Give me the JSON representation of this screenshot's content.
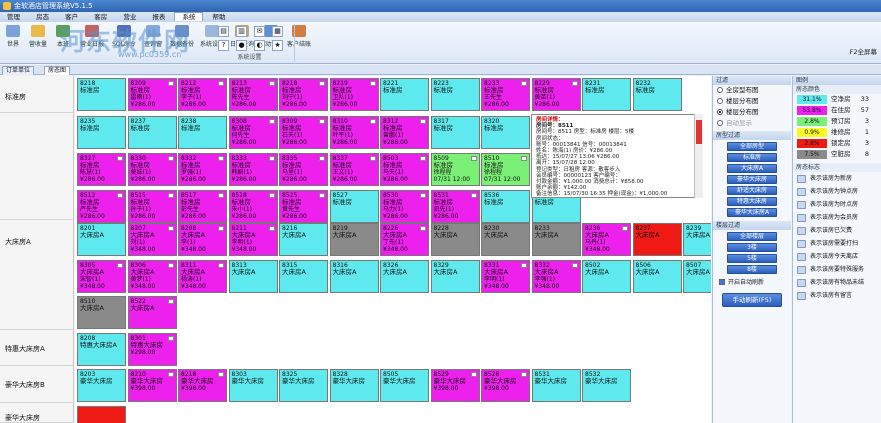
{
  "app": {
    "title": "金软酒店管理系统V5.1.5"
  },
  "menu": [
    "管理",
    "房态",
    "客户",
    "客房",
    "营业",
    "报表",
    "系统",
    "帮助"
  ],
  "menu_active": "系统",
  "ribbon": {
    "buttons": [
      "世界",
      "营收量",
      "本班",
      "营业日报",
      "SQL命令",
      "查询窗",
      "数据备份",
      "系统设置",
      "日志查询",
      "自动设置",
      "客户结账",
      "交接"
    ],
    "group_label": "系统设置",
    "right_status": "F2全屏幕"
  },
  "watermark": {
    "main": "河东软件网",
    "url": "www.pc0359.cn"
  },
  "tabs": [
    "订单单位",
    "房态图"
  ],
  "categories": [
    "标准房",
    "",
    "大床房A",
    "",
    "",
    "特惠大床房A",
    "豪华大床房B",
    "豪华大床房"
  ],
  "colors": {
    "magenta": "#ee20ee",
    "cyan": "#5ee9ee",
    "gray": "#8a8a8a",
    "green": "#7bf076",
    "yellow": "#fafa22",
    "red": "#f01a14"
  },
  "rooms": [
    {
      "r": 0,
      "c": 0,
      "no": "8218",
      "type": "标准房",
      "sub": "",
      "price": "",
      "st": "cyan"
    },
    {
      "r": 0,
      "c": 1,
      "no": "8209",
      "type": "标准房",
      "sub": "雷雨(1)",
      "price": "¥286.00",
      "st": "magenta"
    },
    {
      "r": 0,
      "c": 2,
      "no": "8212",
      "type": "标准房",
      "sub": "李子(1)",
      "price": "¥286.00",
      "st": "magenta"
    },
    {
      "r": 0,
      "c": 3,
      "no": "8213",
      "type": "标准房",
      "sub": "陈先生",
      "price": "¥286.00",
      "st": "magenta"
    },
    {
      "r": 0,
      "c": 4,
      "no": "8218",
      "type": "标准房",
      "sub": "刘宁(1)",
      "price": "¥286.00",
      "st": "magenta"
    },
    {
      "r": 0,
      "c": 5,
      "no": "8219",
      "type": "标准房",
      "sub": "卫队(1)",
      "price": "¥286.00",
      "st": "magenta"
    },
    {
      "r": 0,
      "c": 6,
      "no": "8221",
      "type": "标准房",
      "sub": "",
      "price": "",
      "st": "cyan"
    },
    {
      "r": 0,
      "c": 7,
      "no": "8223",
      "type": "标准房",
      "sub": "",
      "price": "",
      "st": "cyan"
    },
    {
      "r": 0,
      "c": 8,
      "no": "8233",
      "type": "标准房",
      "sub": "王先生",
      "price": "¥286.00",
      "st": "magenta"
    },
    {
      "r": 0,
      "c": 9,
      "no": "8229",
      "type": "标准房",
      "sub": "黄苗(1)",
      "price": "¥286.00",
      "st": "magenta"
    },
    {
      "r": 0,
      "c": 10,
      "no": "8231",
      "type": "标准房",
      "sub": "",
      "price": "",
      "st": "cyan"
    },
    {
      "r": 0,
      "c": 11,
      "no": "8232",
      "type": "标准房",
      "sub": "",
      "price": "",
      "st": "cyan"
    },
    {
      "r": 1,
      "c": 0,
      "no": "8235",
      "type": "标准房",
      "sub": "",
      "price": "",
      "st": "cyan"
    },
    {
      "r": 1,
      "c": 1,
      "no": "8237",
      "type": "标准房",
      "sub": "",
      "price": "",
      "st": "cyan"
    },
    {
      "r": 1,
      "c": 2,
      "no": "8238",
      "type": "标准房",
      "sub": "",
      "price": "",
      "st": "cyan"
    },
    {
      "r": 1,
      "c": 3,
      "no": "8308",
      "type": "标准房",
      "sub": "何先生",
      "price": "¥286.00",
      "st": "magenta"
    },
    {
      "r": 1,
      "c": 4,
      "no": "8309",
      "type": "标准房",
      "sub": "石天(1)",
      "price": "¥286.00",
      "st": "magenta"
    },
    {
      "r": 1,
      "c": 5,
      "no": "8310",
      "type": "标准房",
      "sub": "叶平(1)",
      "price": "¥286.00",
      "st": "magenta"
    },
    {
      "r": 1,
      "c": 6,
      "no": "8312",
      "type": "标准房",
      "sub": "曾鹏(1)",
      "price": "¥286.00",
      "st": "magenta"
    },
    {
      "r": 1,
      "c": 7,
      "no": "8317",
      "type": "标准房",
      "sub": "",
      "price": "",
      "st": "cyan"
    },
    {
      "r": 1,
      "c": 8,
      "no": "8320",
      "type": "标准房",
      "sub": "",
      "price": "",
      "st": "cyan"
    },
    {
      "r": 1,
      "c": 9,
      "no": "8321",
      "type": "标准房",
      "sub": "",
      "price": "",
      "st": "yellow"
    },
    {
      "r": 2,
      "c": 0,
      "no": "8327",
      "type": "标准房",
      "sub": "陈慧(1)",
      "price": "¥286.00",
      "st": "magenta"
    },
    {
      "r": 2,
      "c": 1,
      "no": "8330",
      "type": "标准房",
      "sub": "莫妹(1)",
      "price": "¥286.00",
      "st": "magenta"
    },
    {
      "r": 2,
      "c": 2,
      "no": "8332",
      "type": "标准房",
      "sub": "罗强(1)",
      "price": "¥286.00",
      "st": "magenta"
    },
    {
      "r": 2,
      "c": 3,
      "no": "8333",
      "type": "标准房",
      "sub": "韩剧(1)",
      "price": "¥286.00",
      "st": "magenta"
    },
    {
      "r": 2,
      "c": 4,
      "no": "8335",
      "type": "标准房",
      "sub": "马里(1)",
      "price": "¥286.00",
      "st": "magenta"
    },
    {
      "r": 2,
      "c": 5,
      "no": "8337",
      "type": "标准房",
      "sub": "王文(1)",
      "price": "¥286.00",
      "st": "magenta"
    },
    {
      "r": 2,
      "c": 6,
      "no": "8503",
      "type": "标准房",
      "sub": "马天(1)",
      "price": "¥286.00",
      "st": "magenta"
    },
    {
      "r": 2,
      "c": 7,
      "no": "8509",
      "type": "标准房",
      "sub": "徐程程",
      "price": "07/31 12:00",
      "st": "green"
    },
    {
      "r": 2,
      "c": 8,
      "no": "8510",
      "type": "标准房",
      "sub": "徐程程",
      "price": "07/31 12:00",
      "st": "green"
    },
    {
      "r": 2,
      "c": 9,
      "no": "8511",
      "type": "标准房",
      "sub": "陈海(1)",
      "price": "",
      "st": "yellow"
    },
    {
      "r": 3,
      "c": 0,
      "no": "8512",
      "type": "标准房",
      "sub": "严先生",
      "price": "¥286.00",
      "st": "magenta"
    },
    {
      "r": 3,
      "c": 1,
      "no": "8515",
      "type": "标准房",
      "sub": "孙子(1)",
      "price": "¥286.00",
      "st": "magenta"
    },
    {
      "r": 3,
      "c": 2,
      "no": "8517",
      "type": "标准房",
      "sub": "彭先生",
      "price": "¥286.00",
      "st": "magenta"
    },
    {
      "r": 3,
      "c": 3,
      "no": "8518",
      "type": "标准房",
      "sub": "朱小(1)",
      "price": "¥286.00",
      "st": "magenta"
    },
    {
      "r": 3,
      "c": 4,
      "no": "8525",
      "type": "标准房",
      "sub": "黄先生",
      "price": "¥286.00",
      "st": "magenta"
    },
    {
      "r": 3,
      "c": 5,
      "no": "8527",
      "type": "标准房",
      "sub": "",
      "price": "",
      "st": "cyan"
    },
    {
      "r": 3,
      "c": 6,
      "no": "8530",
      "type": "标准房",
      "sub": "马力(1)",
      "price": "¥286.00",
      "st": "magenta"
    },
    {
      "r": 3,
      "c": 7,
      "no": "8531",
      "type": "标准房",
      "sub": "凯先(1)",
      "price": "¥286.00",
      "st": "magenta"
    },
    {
      "r": 3,
      "c": 8,
      "no": "8536",
      "type": "标准房",
      "sub": "",
      "price": "",
      "st": "cyan"
    },
    {
      "r": 3,
      "c": 9,
      "no": "8538",
      "type": "标准房",
      "sub": "",
      "price": "",
      "st": "cyan"
    },
    {
      "r": 4,
      "c": 0,
      "no": "8201",
      "type": "大床房A",
      "sub": "",
      "price": "",
      "st": "cyan"
    },
    {
      "r": 4,
      "c": 1,
      "no": "8207",
      "type": "大床房A",
      "sub": "刘(1)",
      "price": "¥348.00",
      "st": "magenta"
    },
    {
      "r": 4,
      "c": 2,
      "no": "8208",
      "type": "大床房A",
      "sub": "李(1)",
      "price": "¥348.00",
      "st": "magenta"
    },
    {
      "r": 4,
      "c": 3,
      "no": "8211",
      "type": "大床房A",
      "sub": "李明(1)",
      "price": "¥348.00",
      "st": "magenta"
    },
    {
      "r": 4,
      "c": 4,
      "no": "8216",
      "type": "大床房A",
      "sub": "",
      "price": "",
      "st": "cyan"
    },
    {
      "r": 4,
      "c": 5,
      "no": "8219",
      "type": "大床房A",
      "sub": "",
      "price": "",
      "st": "gray"
    },
    {
      "r": 4,
      "c": 6,
      "no": "8226",
      "type": "大床房A",
      "sub": "丁先(1)",
      "price": "¥348.00",
      "st": "magenta"
    },
    {
      "r": 4,
      "c": 7,
      "no": "8228",
      "type": "大床房A",
      "sub": "",
      "price": "",
      "st": "gray"
    },
    {
      "r": 4,
      "c": 8,
      "no": "8230",
      "type": "大床房A",
      "sub": "",
      "price": "",
      "st": "gray"
    },
    {
      "r": 4,
      "c": 9,
      "no": "8233",
      "type": "大床房A",
      "sub": "",
      "price": "",
      "st": "gray"
    },
    {
      "r": 4,
      "c": 10,
      "no": "8236",
      "type": "大床房A",
      "sub": "马丹(1)",
      "price": "¥348.00",
      "st": "magenta"
    },
    {
      "r": 4,
      "c": 11,
      "no": "8237",
      "type": "大床房A",
      "sub": "",
      "price": "",
      "st": "red"
    },
    {
      "r": 4,
      "c": 12,
      "no": "8239",
      "type": "大床房A",
      "sub": "",
      "price": "",
      "st": "cyan"
    },
    {
      "r": 5,
      "c": 0,
      "no": "8305",
      "type": "大床房A",
      "sub": "宋智(1)",
      "price": "¥348.00",
      "st": "magenta"
    },
    {
      "r": 5,
      "c": 1,
      "no": "8306",
      "type": "大床房A",
      "sub": "黄梦(1)",
      "price": "¥348.00",
      "st": "magenta"
    },
    {
      "r": 5,
      "c": 2,
      "no": "8311",
      "type": "大床房A",
      "sub": "杨涛(1)",
      "price": "¥348.00",
      "st": "magenta"
    },
    {
      "r": 5,
      "c": 3,
      "no": "8313",
      "type": "大床房A",
      "sub": "",
      "price": "",
      "st": "cyan"
    },
    {
      "r": 5,
      "c": 4,
      "no": "8315",
      "type": "大床房A",
      "sub": "",
      "price": "",
      "st": "cyan"
    },
    {
      "r": 5,
      "c": 5,
      "no": "8316",
      "type": "大床房A",
      "sub": "",
      "price": "",
      "st": "cyan"
    },
    {
      "r": 5,
      "c": 6,
      "no": "8326",
      "type": "大床房A",
      "sub": "",
      "price": "",
      "st": "cyan"
    },
    {
      "r": 5,
      "c": 7,
      "no": "8329",
      "type": "大床房A",
      "sub": "",
      "price": "",
      "st": "cyan"
    },
    {
      "r": 5,
      "c": 8,
      "no": "8331",
      "type": "大床房A",
      "sub": "李明(1)",
      "price": "¥348.00",
      "st": "magenta"
    },
    {
      "r": 5,
      "c": 9,
      "no": "8332",
      "type": "大床房A",
      "sub": "李强(1)",
      "price": "¥348.00",
      "st": "magenta"
    },
    {
      "r": 5,
      "c": 10,
      "no": "8502",
      "type": "大床房A",
      "sub": "",
      "price": "",
      "st": "cyan"
    },
    {
      "r": 5,
      "c": 11,
      "no": "8506",
      "type": "大床房A",
      "sub": "",
      "price": "",
      "st": "cyan"
    },
    {
      "r": 5,
      "c": 12,
      "no": "8507",
      "type": "大床房A",
      "sub": "",
      "price": "",
      "st": "cyan"
    },
    {
      "r": 6,
      "c": 0,
      "no": "8510",
      "type": "大床房A",
      "sub": "",
      "price": "",
      "st": "gray"
    },
    {
      "r": 6,
      "c": 1,
      "no": "8522",
      "type": "大床房A",
      "sub": "",
      "price": "",
      "st": "magenta"
    },
    {
      "r": 7,
      "c": 0,
      "no": "8208",
      "type": "特惠大床房A",
      "sub": "",
      "price": "",
      "st": "cyan"
    },
    {
      "r": 7,
      "c": 1,
      "no": "8301",
      "type": "特惠大床房",
      "sub": "",
      "price": "¥298.00",
      "st": "magenta"
    },
    {
      "r": 8,
      "c": 0,
      "no": "8203",
      "type": "豪华大床房",
      "sub": "",
      "price": "",
      "st": "cyan"
    },
    {
      "r": 8,
      "c": 1,
      "no": "8210",
      "type": "豪华大床房",
      "sub": "",
      "price": "¥398.00",
      "st": "magenta"
    },
    {
      "r": 8,
      "c": 2,
      "no": "8218",
      "type": "豪华大床房",
      "sub": "",
      "price": "¥398.00",
      "st": "magenta"
    },
    {
      "r": 8,
      "c": 3,
      "no": "8303",
      "type": "豪华大床房",
      "sub": "",
      "price": "",
      "st": "cyan"
    },
    {
      "r": 8,
      "c": 4,
      "no": "8325",
      "type": "豪华大床房",
      "sub": "",
      "price": "",
      "st": "cyan"
    },
    {
      "r": 8,
      "c": 5,
      "no": "8328",
      "type": "豪华大床房",
      "sub": "",
      "price": "",
      "st": "cyan"
    },
    {
      "r": 8,
      "c": 6,
      "no": "8505",
      "type": "豪华大床房",
      "sub": "",
      "price": "",
      "st": "cyan"
    },
    {
      "r": 8,
      "c": 7,
      "no": "8529",
      "type": "豪华大床房",
      "sub": "",
      "price": "¥398.00",
      "st": "magenta"
    },
    {
      "r": 8,
      "c": 8,
      "no": "8526",
      "type": "豪华大床房",
      "sub": "",
      "price": "¥398.00",
      "st": "magenta"
    },
    {
      "r": 8,
      "c": 9,
      "no": "8531",
      "type": "豪华大床房",
      "sub": "",
      "price": "",
      "st": "cyan"
    },
    {
      "r": 8,
      "c": 10,
      "no": "8532",
      "type": "豪华大床房",
      "sub": "",
      "price": "",
      "st": "cyan"
    },
    {
      "r": 9,
      "c": 0,
      "no": "",
      "type": "",
      "sub": "",
      "price": "",
      "st": "red"
    }
  ],
  "popup": {
    "title": "房间详情：",
    "lines": [
      "房间号：8511",
      "房间号：8511  房型：标准房  楼层：5楼",
      "房间状态：",
      "账号：00013841  信号：00013841",
      "姓名：陈海(1)  房价：¥286.00",
      "抵达：15/07/27  13:06  ¥286.00",
      "离开：15/07/28  12:00",
      "登记类型：日租房  客源：散客步入",
      "会员编号：00000123  客户编号：",
      "付款金额：¥1,000.00  消费总计：¥858.00",
      "账户余额：¥142.00",
      "备注信息：15/07/30 16:35 押金(现金)：¥1,000.00",
      "15/07/28 13:06 续租：¥2,000.00",
      "15/07/27 13:06 订单编号#0000596入住",
      "#0000123 首单价签签约日期"
    ]
  },
  "filter_panel": {
    "header": "过滤",
    "view_options": [
      "全房型布图",
      "楼层分布图",
      "楼层分布图",
      "自动显示"
    ],
    "room_type_header": "房型过滤",
    "room_types": [
      "全部房型",
      "标准房",
      "大床房A",
      "豪华大床房",
      "舒适大床房",
      "特惠大床房",
      "豪华大床房A"
    ],
    "floor_header": "楼层过滤",
    "floors": [
      "全部楼层",
      "3楼",
      "5楼",
      "8楼"
    ],
    "auto_refresh": "开启自动刷新",
    "manual_refresh": "手动刷新(F5)"
  },
  "status_panel": {
    "header": "图例",
    "color_header": "房态颜色",
    "legend": [
      {
        "pct": "31.1%",
        "label": "空净房",
        "count": "33",
        "color": "#5ee9ee"
      },
      {
        "pct": "53.8%",
        "label": "在住房",
        "count": "57",
        "color": "#ee20ee"
      },
      {
        "pct": "2.8%",
        "label": "预订房",
        "count": "3",
        "color": "#7bf076"
      },
      {
        "pct": "0.9%",
        "label": "维修房",
        "count": "1",
        "color": "#fafa22"
      },
      {
        "pct": "2.8%",
        "label": "锁定房",
        "count": "3",
        "color": "#f01a14"
      },
      {
        "pct": "7.5%",
        "label": "空脏房",
        "count": "8",
        "color": "#8a8a8a"
      }
    ],
    "marks_header": "房态标志",
    "marks": [
      "表示该房为新房",
      "表示该房为钟点房",
      "表示该房为时点房",
      "表示该房为会员房",
      "表示该房已欠费",
      "表示该房需要打扫",
      "表示该房今天离店",
      "表示该房要特殊服务",
      "表示该房有物品未结",
      "表示该房有留言"
    ]
  }
}
